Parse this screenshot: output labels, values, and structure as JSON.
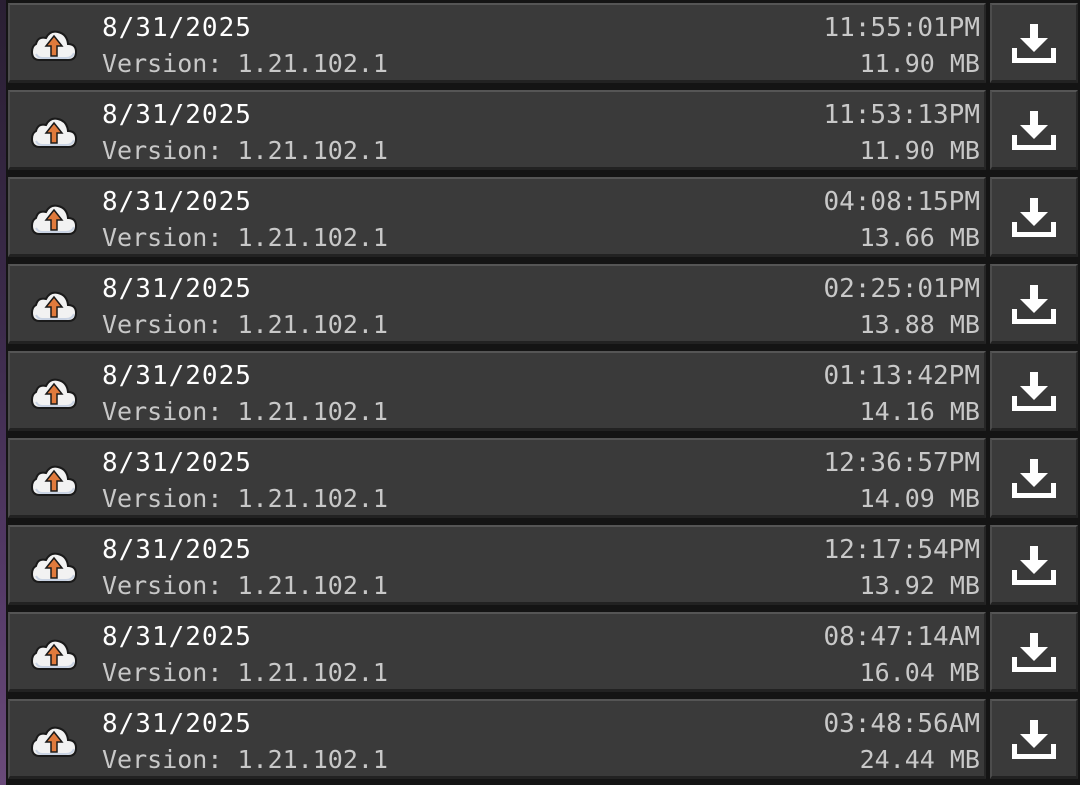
{
  "backups": [
    {
      "date": "8/31/2025",
      "version": "Version: 1.21.102.1",
      "time": "11:55:01PM",
      "size": "11.90 MB"
    },
    {
      "date": "8/31/2025",
      "version": "Version: 1.21.102.1",
      "time": "11:53:13PM",
      "size": "11.90 MB"
    },
    {
      "date": "8/31/2025",
      "version": "Version: 1.21.102.1",
      "time": "04:08:15PM",
      "size": "13.66 MB"
    },
    {
      "date": "8/31/2025",
      "version": "Version: 1.21.102.1",
      "time": "02:25:01PM",
      "size": "13.88 MB"
    },
    {
      "date": "8/31/2025",
      "version": "Version: 1.21.102.1",
      "time": "01:13:42PM",
      "size": "14.16 MB"
    },
    {
      "date": "8/31/2025",
      "version": "Version: 1.21.102.1",
      "time": "12:36:57PM",
      "size": "14.09 MB"
    },
    {
      "date": "8/31/2025",
      "version": "Version: 1.21.102.1",
      "time": "12:17:54PM",
      "size": "13.92 MB"
    },
    {
      "date": "8/31/2025",
      "version": "Version: 1.21.102.1",
      "time": "08:47:14AM",
      "size": "16.04 MB"
    },
    {
      "date": "8/31/2025",
      "version": "Version: 1.21.102.1",
      "time": "03:48:56AM",
      "size": "24.44 MB"
    }
  ],
  "icons": {
    "entry_icon": "cloud-upload-icon",
    "action_icon": "download-icon"
  },
  "colors": {
    "row_background": "#3a3a3a",
    "primary_text": "#ffffff",
    "secondary_text": "#c8c8c8",
    "arrow_accent": "#e07a3c"
  }
}
